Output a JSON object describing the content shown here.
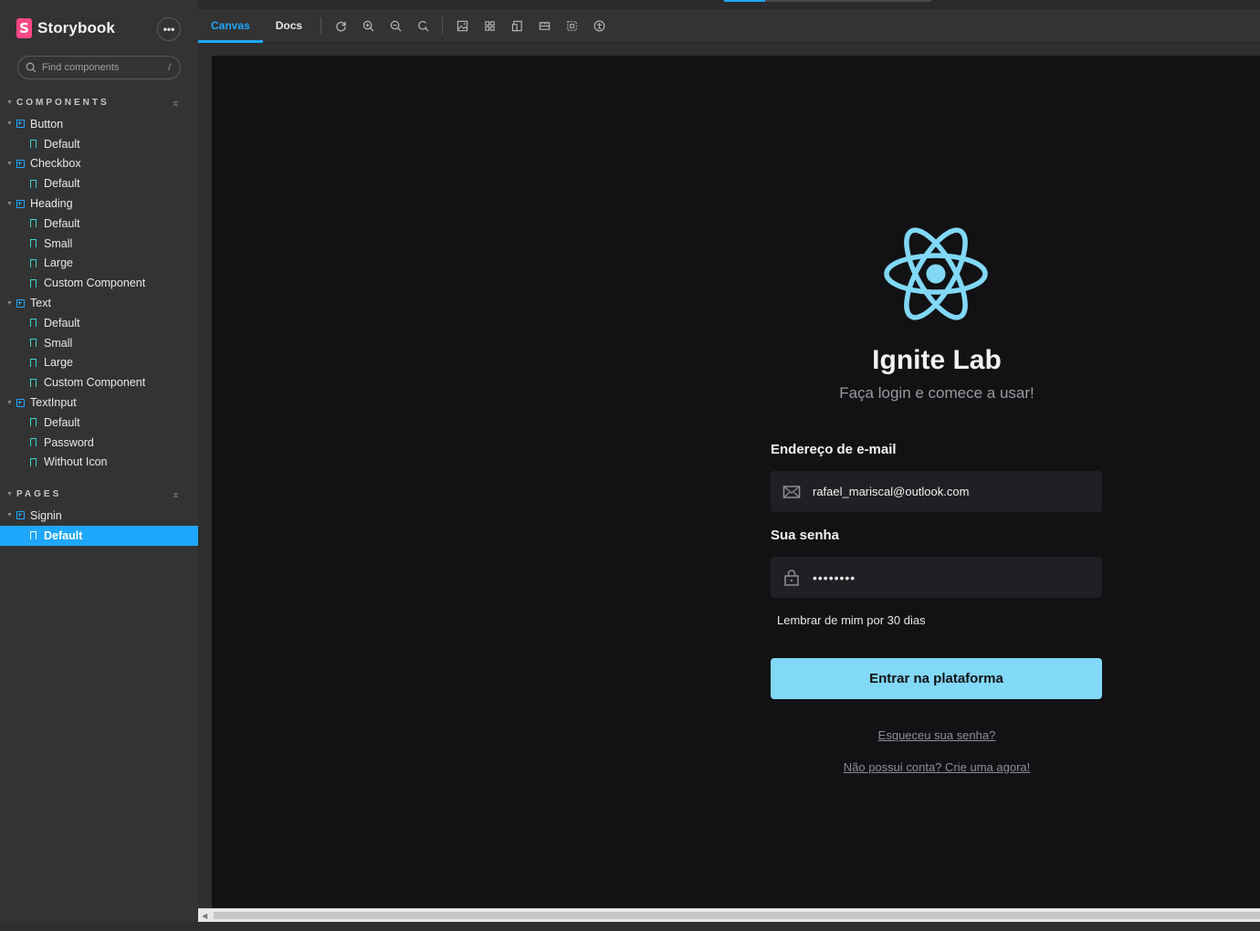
{
  "sidebar": {
    "brand": "Storybook",
    "brand_letter": "S",
    "more_label": "•••",
    "search_placeholder": "Find components",
    "search_shortcut": "/",
    "components_title": "COMPONENTS",
    "pages_title": "PAGES",
    "collapse_glyph": "⌅",
    "components": [
      {
        "name": "Button",
        "stories": [
          "Default"
        ]
      },
      {
        "name": "Checkbox",
        "stories": [
          "Default"
        ]
      },
      {
        "name": "Heading",
        "stories": [
          "Default",
          "Small",
          "Large",
          "Custom Component"
        ]
      },
      {
        "name": "Text",
        "stories": [
          "Default",
          "Small",
          "Large",
          "Custom Component"
        ]
      },
      {
        "name": "TextInput",
        "stories": [
          "Default",
          "Password",
          "Without Icon"
        ]
      }
    ],
    "pages": [
      {
        "name": "Signin",
        "stories": [
          "Default"
        ],
        "selected_story": "Default"
      }
    ]
  },
  "toolbar": {
    "tabs": [
      {
        "label": "Canvas",
        "active": true
      },
      {
        "label": "Docs",
        "active": false
      }
    ],
    "icons": [
      "reload-icon",
      "zoom-in-icon",
      "zoom-out-icon",
      "zoom-reset-icon",
      "background-icon",
      "grid-icon",
      "viewport-icon",
      "measure-icon",
      "outline-icon",
      "accessibility-icon"
    ]
  },
  "login": {
    "title": "Ignite Lab",
    "subtitle": "Faça login e comece a usar!",
    "email_label": "Endereço de e-mail",
    "email_value": "rafael_mariscal@outlook.com",
    "password_label": "Sua senha",
    "password_value": "••••••••",
    "remember_label": "Lembrar de mim por 30 dias",
    "submit_label": "Entrar na plataforma",
    "forgot_link": "Esqueceu sua senha?",
    "signup_link": "Não possui conta? Crie uma agora!"
  },
  "colors": {
    "accent": "#1ea7fd",
    "cyan": "#81d8f7",
    "canvas_bg": "#121214",
    "input_bg": "#202024"
  }
}
